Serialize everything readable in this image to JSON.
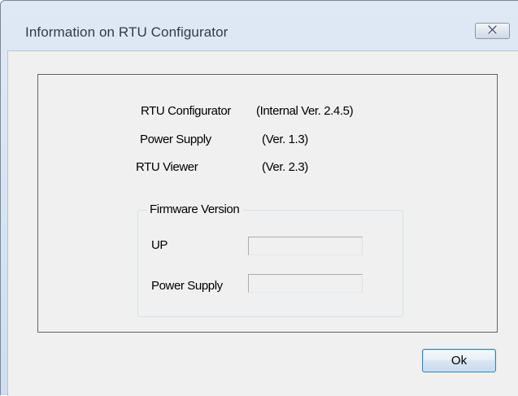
{
  "window": {
    "title": "Information on RTU Configurator",
    "close_icon": "close-icon"
  },
  "info": [
    {
      "label": "RTU Configurator",
      "value": "(Internal Ver. 2.4.5)"
    },
    {
      "label": "Power Supply",
      "value": "(Ver. 1.3)"
    },
    {
      "label": "RTU Viewer",
      "value": "(Ver. 2.3)"
    }
  ],
  "firmware": {
    "title": "Firmware Version",
    "fields": [
      {
        "label": "UP",
        "value": ""
      },
      {
        "label": "Power Supply",
        "value": ""
      }
    ]
  },
  "buttons": {
    "ok_label": "Ok"
  },
  "colors": {
    "title_bar": "#d6e3f2",
    "dialog_face": "#f0f0f0",
    "button_border": "#3c7fb1"
  }
}
